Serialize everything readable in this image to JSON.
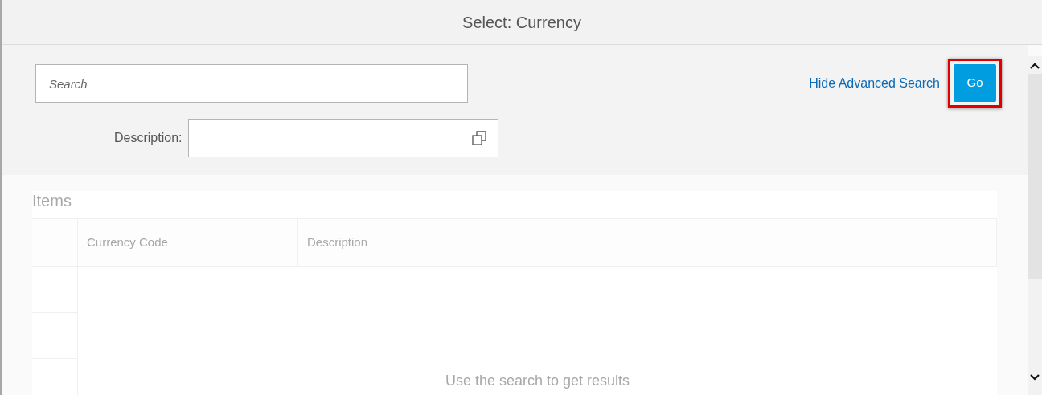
{
  "dialog": {
    "title": "Select: Currency"
  },
  "search": {
    "placeholder": "Search"
  },
  "filters": [
    {
      "label": "Description:",
      "value_help": true
    }
  ],
  "toggle_link": "Hide Advanced Search",
  "go_button": {
    "label": "Go",
    "highlighted": true
  },
  "table": {
    "title": "Items",
    "columns": [
      "Currency Code",
      "Description"
    ],
    "empty_text": "Use the search to get results"
  }
}
